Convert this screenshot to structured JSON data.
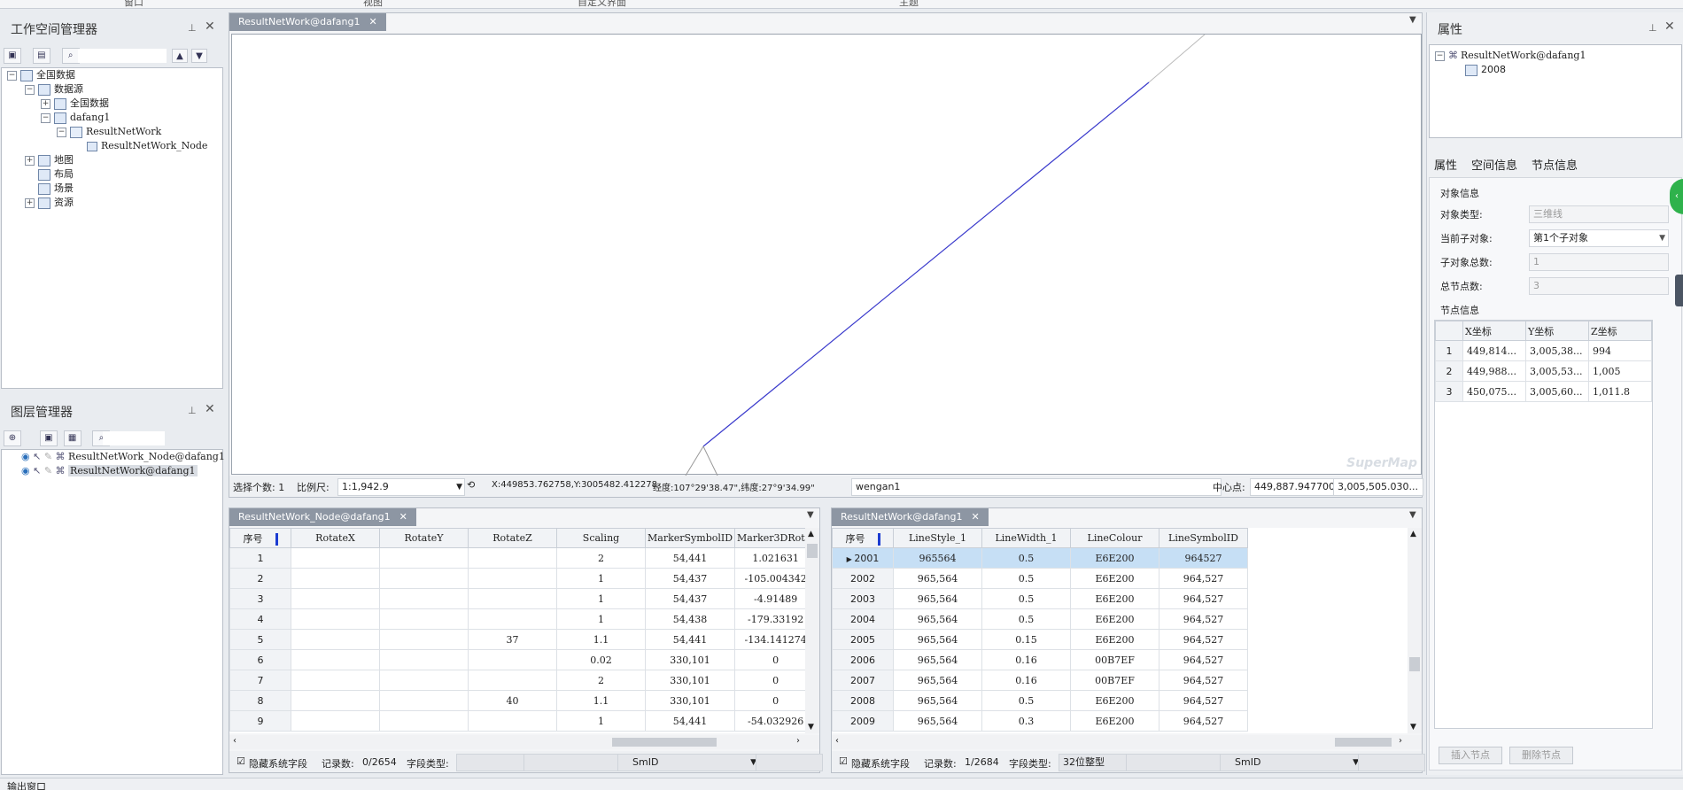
{
  "menubar": {
    "items": [
      "窗口",
      "视图",
      "自定义界面",
      "主题"
    ]
  },
  "workspace": {
    "title": "工作空间管理器",
    "tree": [
      {
        "label": "全国数据",
        "level": 0,
        "exp": "-"
      },
      {
        "label": "数据源",
        "level": 1,
        "exp": "-"
      },
      {
        "label": "全国数据",
        "level": 2,
        "exp": "+"
      },
      {
        "label": "dafang1",
        "level": 2,
        "exp": "-"
      },
      {
        "label": "ResultNetWork",
        "level": 3,
        "exp": "-"
      },
      {
        "label": "ResultNetWork_Node",
        "level": 4,
        "exp": ""
      },
      {
        "label": "地图",
        "level": 1,
        "exp": "+"
      },
      {
        "label": "布局",
        "level": 1,
        "exp": ""
      },
      {
        "label": "场景",
        "level": 1,
        "exp": ""
      },
      {
        "label": "资源",
        "level": 1,
        "exp": "+"
      }
    ]
  },
  "layers": {
    "title": "图层管理器",
    "items": [
      {
        "label": "ResultNetWork_Node@dafang1"
      },
      {
        "label": "ResultNetWork@dafang1"
      }
    ]
  },
  "map": {
    "tab": "ResultNetWork@dafang1",
    "watermark": "SuperMap",
    "status": {
      "select_label": "选择个数: 1",
      "scale_label": "比例尺:",
      "scale_value": "1:1,942.9",
      "coords": "X:449853.762758,Y:3005482.412278",
      "lonlat": "经度:107°29'38.47\",纬度:27°9'34.99\"",
      "name": "wengan1",
      "center_label": "中心点:",
      "center_x": "449,887.947700",
      "center_y": "3,005,505.030..."
    }
  },
  "table_left": {
    "tab": "ResultNetWork_Node@dafang1",
    "headers": [
      "序号",
      "RotateX",
      "RotateY",
      "RotateZ",
      "Scaling",
      "MarkerSymbolID",
      "Marker3DRot..."
    ],
    "rows": [
      [
        "1",
        "",
        "",
        "",
        "2",
        "54,441",
        "1.021631"
      ],
      [
        "2",
        "",
        "",
        "",
        "1",
        "54,437",
        "-105.004342"
      ],
      [
        "3",
        "",
        "",
        "",
        "1",
        "54,437",
        "-4.91489"
      ],
      [
        "4",
        "",
        "",
        "",
        "1",
        "54,438",
        "-179.33192"
      ],
      [
        "5",
        "",
        "",
        "37",
        "1.1",
        "54,441",
        "-134.141274"
      ],
      [
        "6",
        "",
        "",
        "",
        "0.02",
        "330,101",
        "0"
      ],
      [
        "7",
        "",
        "",
        "",
        "2",
        "330,101",
        "0"
      ],
      [
        "8",
        "",
        "",
        "40",
        "1.1",
        "330,101",
        "0"
      ],
      [
        "9",
        "",
        "",
        "",
        "1",
        "54,441",
        "-54.032926"
      ]
    ],
    "footer": {
      "hide_label": "隐藏系统字段",
      "record_label": "记录数:",
      "record_value": "0/2654",
      "type_label": "字段类型:",
      "type_value": "",
      "field_value": "SmID"
    }
  },
  "table_right": {
    "tab": "ResultNetWork@dafang1",
    "headers": [
      "序号",
      "LineStyle_1",
      "LineWidth_1",
      "LineColour",
      "LineSymbolID"
    ],
    "rows": [
      [
        "2001",
        "965564",
        "0.5",
        "E6E200",
        "964527"
      ],
      [
        "2002",
        "965,564",
        "0.5",
        "E6E200",
        "964,527"
      ],
      [
        "2003",
        "965,564",
        "0.5",
        "E6E200",
        "964,527"
      ],
      [
        "2004",
        "965,564",
        "0.5",
        "E6E200",
        "964,527"
      ],
      [
        "2005",
        "965,564",
        "0.15",
        "E6E200",
        "964,527"
      ],
      [
        "2006",
        "965,564",
        "0.16",
        "00B7EF",
        "964,527"
      ],
      [
        "2007",
        "965,564",
        "0.16",
        "00B7EF",
        "964,527"
      ],
      [
        "2008",
        "965,564",
        "0.5",
        "E6E200",
        "964,527"
      ],
      [
        "2009",
        "965,564",
        "0.3",
        "E6E200",
        "964,527"
      ]
    ],
    "footer": {
      "hide_label": "隐藏系统字段",
      "record_label": "记录数:",
      "record_value": "1/2684",
      "type_label": "字段类型:",
      "type_value": "32位整型",
      "field_value": "SmID"
    }
  },
  "properties": {
    "title": "属性",
    "tree_root": "ResultNetWork@dafang1",
    "tree_child": "2008",
    "tabs": [
      "属性",
      "空间信息",
      "节点信息"
    ],
    "object_group": "对象信息",
    "obj_type_label": "对象类型:",
    "obj_type_value": "三维线",
    "cur_sub_label": "当前子对象:",
    "cur_sub_value": "第1个子对象",
    "sub_total_label": "子对象总数:",
    "sub_total_value": "1",
    "node_total_label": "总节点数:",
    "node_total_value": "3",
    "node_group": "节点信息",
    "node_headers": [
      "X坐标",
      "Y坐标",
      "Z坐标"
    ],
    "node_rows": [
      [
        "1",
        "449,814...",
        "3,005,38...",
        "994"
      ],
      [
        "2",
        "449,988...",
        "3,005,53...",
        "1,005"
      ],
      [
        "3",
        "450,075...",
        "3,005,60...",
        "1,011.8"
      ]
    ],
    "insert_btn": "插入节点",
    "delete_btn": "删除节点"
  },
  "output": {
    "title": "输出窗口"
  },
  "colors": {
    "selected_row": "#c6dff5",
    "line": "#3a3acc",
    "tab_bg": "#8d96a3"
  }
}
